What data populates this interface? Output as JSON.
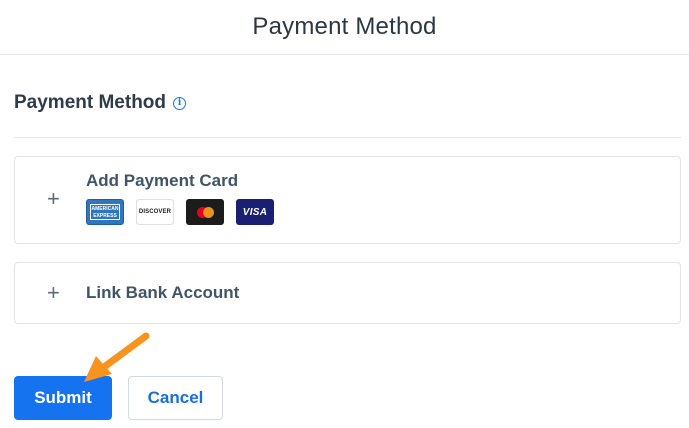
{
  "header": {
    "title": "Payment Method"
  },
  "section": {
    "title": "Payment Method",
    "info_icon": "info-icon"
  },
  "options": {
    "add_card": {
      "label": "Add Payment Card",
      "icon": "plus-icon",
      "card_logos": [
        {
          "name": "amex",
          "text": "AMERICAN EXPRESS"
        },
        {
          "name": "discover",
          "text": "DISCOVER"
        },
        {
          "name": "mastercard",
          "text": ""
        },
        {
          "name": "visa",
          "text": "VISA"
        }
      ]
    },
    "link_bank": {
      "label": "Link Bank Account",
      "icon": "plus-icon"
    }
  },
  "actions": {
    "submit_label": "Submit",
    "cancel_label": "Cancel"
  },
  "colors": {
    "primary": "#1673f0",
    "annotation_arrow": "#f7941d"
  }
}
